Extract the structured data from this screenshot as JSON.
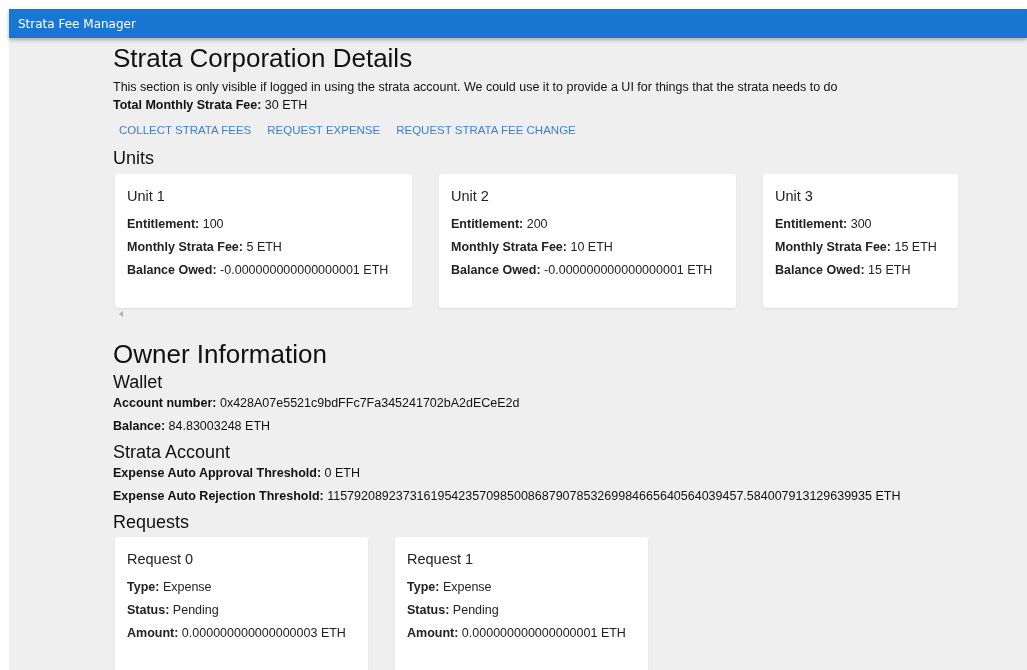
{
  "app_bar": {
    "title": "Strata Fee Manager"
  },
  "strata": {
    "title": "Strata Corporation Details",
    "description": "This section is only visible if logged in using the strata account. We could use it to provide a UI for things that the strata needs to do",
    "total_fee": "**Total Monthly Strata Fee:** 30 ETH",
    "actions": [
      "COLLECT STRATA FEES",
      "REQUEST EXPENSE",
      "REQUEST STRATA FEE CHANGE"
    ],
    "units_heading": "Units",
    "units": [
      {
        "title": "Unit 1",
        "lines": [
          "**Entitlement:** 100",
          "**Monthly Strata Fee:** 5 ETH",
          "**Balance Owed:** -0.000000000000000001 ETH"
        ]
      },
      {
        "title": "Unit 2",
        "lines": [
          "**Entitlement:** 200",
          "**Monthly Strata Fee:** 10 ETH",
          "**Balance Owed:** -0.000000000000000001 ETH"
        ]
      },
      {
        "title": "Unit 3",
        "lines": [
          "**Entitlement:** 300",
          "**Monthly Strata Fee:** 15 ETH",
          "**Balance Owed:** 15 ETH"
        ]
      }
    ]
  },
  "owner": {
    "title": "Owner Information",
    "wallet_heading": "Wallet",
    "wallet_lines": [
      "**Account number:** 0x428A07e5521c9bdFFc7Fa345241702bA2dECeE2d",
      "**Balance:** 84.83003248 ETH"
    ],
    "strata_account_heading": "Strata Account",
    "strata_account_lines": [
      "**Expense Auto Approval Threshold:** 0 ETH",
      "**Expense Auto Rejection Threshold:** 115792089237316195423570985008687907853269984665640564039457.584007913129639935 ETH"
    ],
    "requests_heading": "Requests",
    "requests": [
      {
        "title": "Request 0",
        "lines": [
          "**Type:** Expense",
          "**Status:** Pending",
          "**Amount:** 0.000000000000000003 ETH"
        ]
      },
      {
        "title": "Request 1",
        "lines": [
          "**Type:** Expense",
          "**Status:** Pending",
          "**Amount:** 0.000000000000000001 ETH"
        ]
      }
    ]
  }
}
